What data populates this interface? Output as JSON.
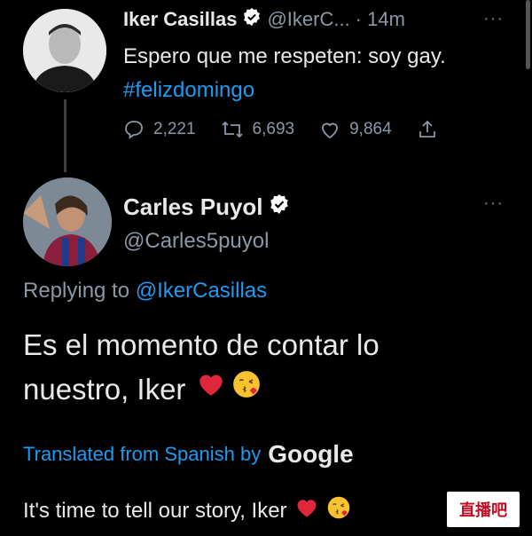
{
  "tweet1": {
    "name": "Iker Casillas",
    "handle": "@IkerC...",
    "time": "· 14m",
    "more": "···",
    "text": "Espero que me respeten: soy gay.",
    "hashtag": "#felizdomingo",
    "replies": "2,221",
    "retweets": "6,693",
    "likes": "9,864"
  },
  "tweet2": {
    "name": "Carles Puyol",
    "handle": "@Carles5puyol",
    "more": "···",
    "replying_prefix": "Replying to ",
    "replying_to": "@IkerCasillas",
    "body_line1": "Es el momento de contar lo",
    "body_line2": "nuestro, Iker",
    "translated_by": "Translated from Spanish by",
    "translator": "Google",
    "translation": "It's time to tell our story, Iker"
  },
  "watermark": "直播吧",
  "colors": {
    "background": "#000000",
    "text": "#e7e9ea",
    "secondary": "#8b98a5",
    "link": "#1d9bf0",
    "verified": "#ffffff"
  },
  "icons": [
    "reply-icon",
    "retweet-icon",
    "like-icon",
    "share-icon",
    "verified-icon",
    "heart-emoji",
    "kiss-emoji"
  ]
}
